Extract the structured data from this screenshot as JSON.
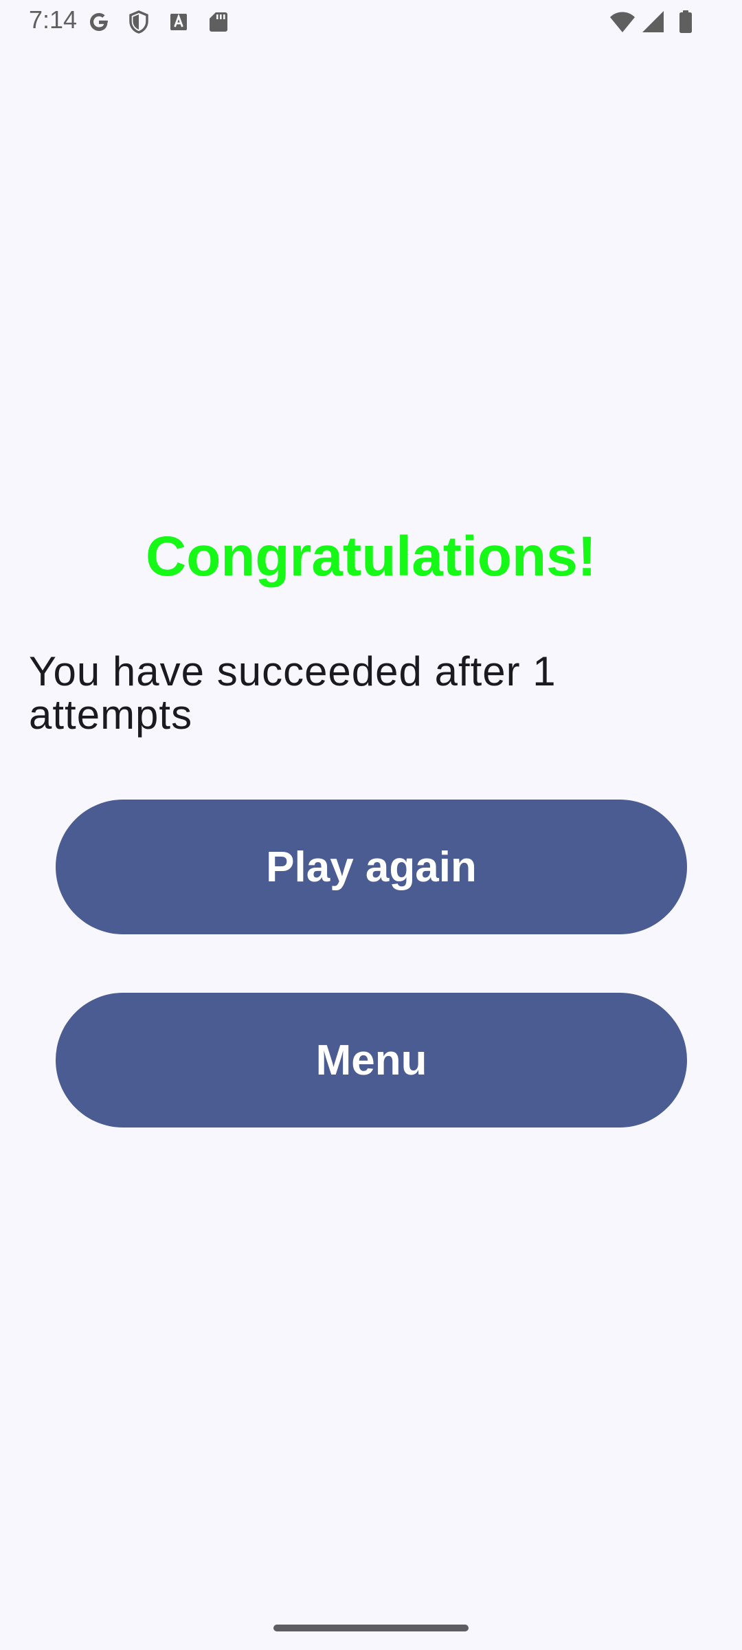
{
  "status_bar": {
    "time": "7:14",
    "left_icons": [
      "google-g-icon",
      "shield-icon",
      "font-a-icon",
      "sd-card-icon"
    ],
    "right_icons": [
      "wifi-icon",
      "cell-signal-icon",
      "battery-icon"
    ]
  },
  "result": {
    "title": "Congratulations!",
    "message": "You have succeeded after 1 attempts"
  },
  "actions": {
    "play_again_label": "Play again",
    "menu_label": "Menu"
  },
  "colors": {
    "background": "#f8f7fd",
    "title": "#16f816",
    "button": "#4a5c91",
    "button_text": "#ffffff"
  }
}
